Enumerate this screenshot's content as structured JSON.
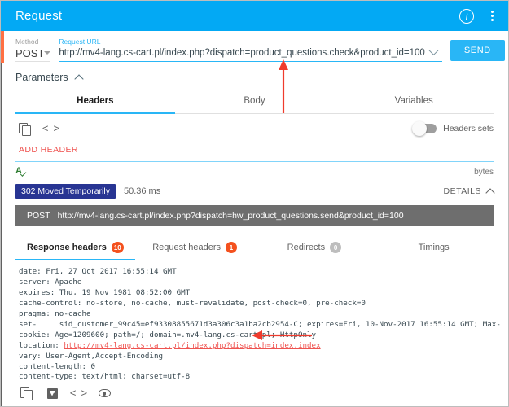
{
  "titlebar": {
    "title": "Request",
    "info_icon": "info-icon",
    "menu_icon": "kebab-menu-icon"
  },
  "request": {
    "method_label": "Method",
    "method_value": "POST",
    "url_label": "Request URL",
    "url_value": "http://mv4-lang.cs-cart.pl/index.php?dispatch=product_questions.check&product_id=100",
    "send_label": "SEND",
    "overflow_icon": "kebab-menu-icon",
    "dropdown_icon": "chevron-down-icon"
  },
  "parameters": {
    "label": "Parameters",
    "collapse_icon": "chevron-up-icon"
  },
  "request_tabs": [
    {
      "label": "Headers",
      "active": true
    },
    {
      "label": "Body",
      "active": false
    },
    {
      "label": "Variables",
      "active": false
    }
  ],
  "headers_toolbar": {
    "copy_icon": "copy-icon",
    "code_icon": "code-icon",
    "code_glyph": "< >",
    "toggle_label": "Headers sets",
    "toggle_on": false
  },
  "add_header_label": "ADD HEADER",
  "size_row": {
    "validate_icon": "text-check-icon",
    "validate_glyph": "A",
    "bytes_label": "bytes"
  },
  "status": {
    "code_text": "302 Moved Temporarily",
    "time_text": "50.36 ms",
    "details_label": "DETAILS",
    "details_icon": "chevron-up-icon",
    "badge_color": "#283593"
  },
  "request_bar": {
    "method": "POST",
    "url": "http://mv4-lang.cs-cart.pl/index.php?dispatch=hw_product_questions.send&product_id=100"
  },
  "response_tabs": [
    {
      "label": "Response headers",
      "badge": "10",
      "badge_style": "red",
      "active": true
    },
    {
      "label": "Request headers",
      "badge": "1",
      "badge_style": "red",
      "active": false
    },
    {
      "label": "Redirects",
      "badge": "0",
      "badge_style": "gray",
      "active": false
    },
    {
      "label": "Timings",
      "badge": "",
      "badge_style": "none",
      "active": false
    }
  ],
  "response_headers": {
    "lines": [
      "date: Fri, 27 Oct 2017 16:55:14 GMT",
      "server: Apache",
      "expires: Thu, 19 Nov 1981 08:52:00 GMT",
      "cache-control: no-store, no-cache, must-revalidate, post-check=0, pre-check=0",
      "pragma: no-cache",
      "set-     sid_customer_99c45=ef93308855671d3a306c3a1ba2cb2954-C; expires=Fri, 10-Nov-2017 16:55:14 GMT; Max-",
      "cookie: Age=1209600; path=/; domain=.mv4-lang.cs-cart.pl; HttpOnly"
    ],
    "location_key": "location: ",
    "location_value": "http://mv4-lang.cs-cart.pl/index.php?dispatch=index.index",
    "lines_after": [
      "vary: User-Agent,Accept-Encoding",
      "content-length: 0",
      "content-type: text/html; charset=utf-8"
    ]
  },
  "bottom_toolbar": {
    "copy_icon": "copy-icon",
    "save_icon": "save-icon",
    "code_icon": "code-icon",
    "code_glyph": "< >",
    "preview_icon": "eye-icon"
  },
  "annotations": {
    "arrow_up": "red-arrow-up-annotation",
    "arrow_left": "red-arrow-left-annotation",
    "color": "#ef3b2d"
  },
  "colors": {
    "accent": "#03a9f4",
    "link": "#29b6f6",
    "danger": "#ef5350",
    "status": "#283593"
  }
}
